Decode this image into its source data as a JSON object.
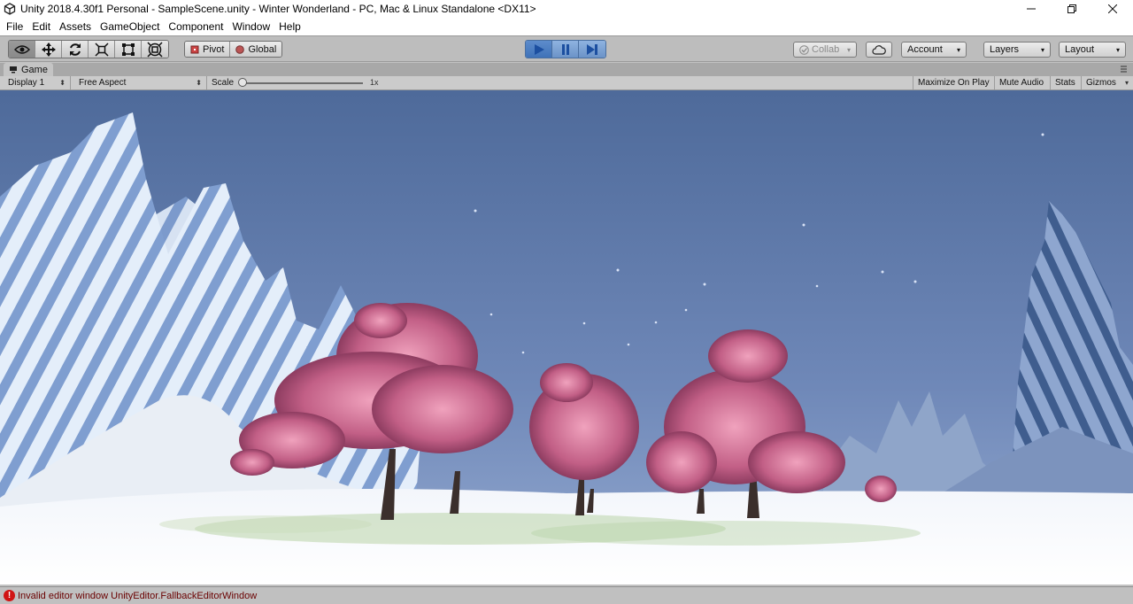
{
  "window": {
    "title": "Unity 2018.4.30f1 Personal - SampleScene.unity - Winter Wonderland - PC, Mac & Linux Standalone <DX11>"
  },
  "menu": [
    "File",
    "Edit",
    "Assets",
    "GameObject",
    "Component",
    "Window",
    "Help"
  ],
  "toolbar": {
    "transform_tools": [
      "view-tool",
      "move-tool",
      "rotate-tool",
      "scale-tool",
      "rect-tool",
      "transform-tool"
    ],
    "pivot_label": "Pivot",
    "global_label": "Global",
    "collab_label": "Collab",
    "account_label": "Account",
    "layers_label": "Layers",
    "layout_label": "Layout"
  },
  "game_panel": {
    "tab_label": "Game",
    "display": "Display 1",
    "aspect": "Free Aspect",
    "scale_label": "Scale",
    "scale_value": "1x",
    "maximize_label": "Maximize On Play",
    "mute_label": "Mute Audio",
    "stats_label": "Stats",
    "gizmos_label": "Gizmos"
  },
  "status": {
    "message": "Invalid editor window UnityEditor.FallbackEditorWindow"
  },
  "colors": {
    "sky_top": "#4e6a9a",
    "sky_bottom": "#7d96c3",
    "error_red": "#d01414",
    "play_blue": "#3f72b8"
  }
}
